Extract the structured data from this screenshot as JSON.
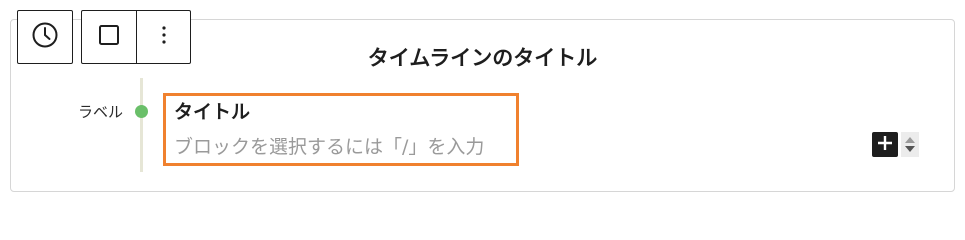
{
  "toolbar": {
    "buttons": [
      {
        "icon": "clock-icon"
      },
      {
        "icon": "square-icon"
      },
      {
        "icon": "vertical-ellipsis-icon"
      }
    ]
  },
  "timeline": {
    "title": "タイムラインのタイトル",
    "item": {
      "label": "ラベル",
      "title": "タイトル",
      "placeholder": "ブロックを選択するには「/」を入力"
    }
  },
  "colors": {
    "accent": "#f0812e",
    "marker": "#6abf69",
    "dark": "#1e1e1e"
  }
}
